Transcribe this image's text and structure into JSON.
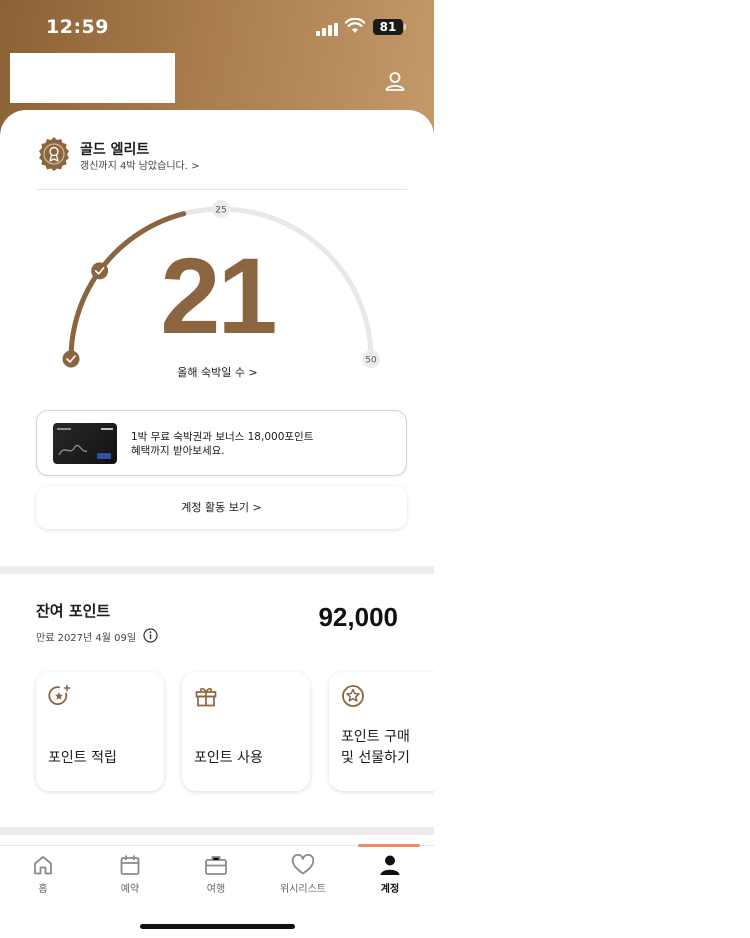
{
  "status_bar": {
    "time": "12:59",
    "battery": "81"
  },
  "tier": {
    "name": "골드 엘리트",
    "renewal": "갱신까지 4박 남았습니다. >"
  },
  "gauge": {
    "nights": "21",
    "marker_mid": "25",
    "marker_end": "50",
    "label": "올해 숙박일 수 >",
    "progress": 21,
    "max": 50
  },
  "promo": {
    "line1": "1박 무료 숙박권과 보너스 18,000포인트",
    "line2": "혜택까지 받아보세요."
  },
  "activity_button": "계정 활동 보기 >",
  "points": {
    "title": "잔여 포인트",
    "expiry": "만료 2027년 4월 09일",
    "balance": "92,000"
  },
  "tiles": [
    {
      "label": "포인트 적립",
      "icon": "sparkle-star-icon"
    },
    {
      "label": "포인트 사용",
      "icon": "gift-icon"
    },
    {
      "label": "포인트 구매\n및 선물하기",
      "icon": "star-circle-icon"
    }
  ],
  "tabs": [
    {
      "label": "홈",
      "icon": "home-icon"
    },
    {
      "label": "예약",
      "icon": "calendar-icon"
    },
    {
      "label": "여행",
      "icon": "briefcase-icon"
    },
    {
      "label": "위시리스트",
      "icon": "heart-icon"
    },
    {
      "label": "계정",
      "icon": "person-icon",
      "active": true
    }
  ],
  "colors": {
    "accent": "#8b6540",
    "header_start": "#8b6235",
    "header_end": "#c49a6a",
    "tab_indicator": "#f08a5d"
  }
}
